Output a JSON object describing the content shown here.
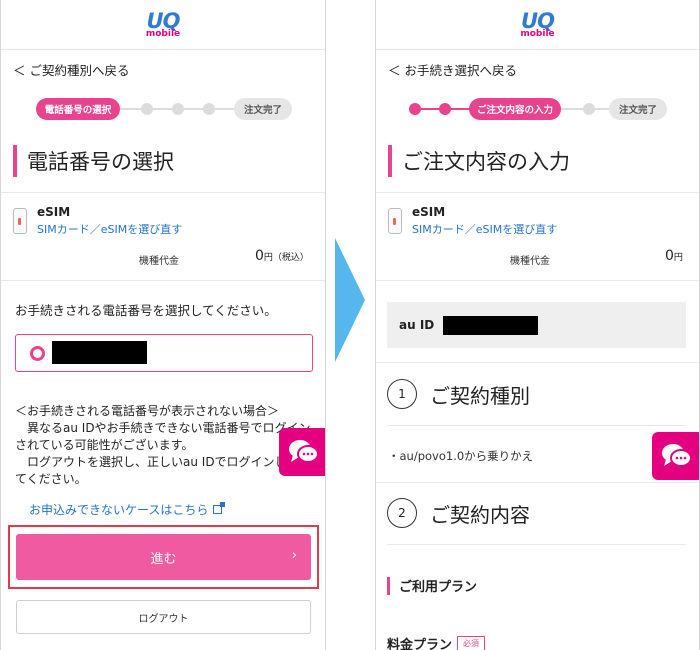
{
  "brand": {
    "logo_uq": "UQ",
    "logo_mobile": "mobile",
    "accent": "#e9438e",
    "link": "#2574c6",
    "arrow": "#56b6ee"
  },
  "left": {
    "back": "＜ ご契約種別へ戻る",
    "stepper": {
      "active": "電話番号の選択",
      "last": "注文完了"
    },
    "title": "電話番号の選択",
    "esim": {
      "name": "eSIM",
      "link": "SIMカード／eSIMを選び直す",
      "price_label": "機種代金",
      "price": "0",
      "unit": "円（税込）"
    },
    "instruction": "お手続きされる電話番号を選択してください。",
    "notice": [
      "＜お手続きされる電話番号が表示されない場合＞",
      "　異なるau IDやお手続きできない電話番号でログイン",
      "されている可能性がございます。",
      "　ログアウトを選択し、正しいau IDでログインし直し",
      "てください。"
    ],
    "notice_link": "お申込みできないケースはこちら",
    "next": "進む",
    "next_chev": "›",
    "logout": "ログアウト"
  },
  "right": {
    "back": "＜ お手続き選択へ戻る",
    "stepper": {
      "active": "ご注文内容の入力",
      "last": "注文完了"
    },
    "title": "ご注文内容の入力",
    "esim": {
      "name": "eSIM",
      "link": "SIMカード／eSIMを選び直す",
      "price_label": "機種代金",
      "price": "0",
      "unit": "円"
    },
    "au_id_label": "au ID",
    "sec1": {
      "num": "1",
      "title": "ご契約種別"
    },
    "plan_row": "・au/povo1.0から乗りかえ",
    "sec2": {
      "num": "2",
      "title": "ご契約内容"
    },
    "sub": "ご利用プラン",
    "cut": "料金プラン",
    "cut_tag": "必須"
  },
  "icons": {
    "chat": "chat-bubble-icon",
    "device": "phone-device-icon",
    "external": "external-link-icon"
  }
}
